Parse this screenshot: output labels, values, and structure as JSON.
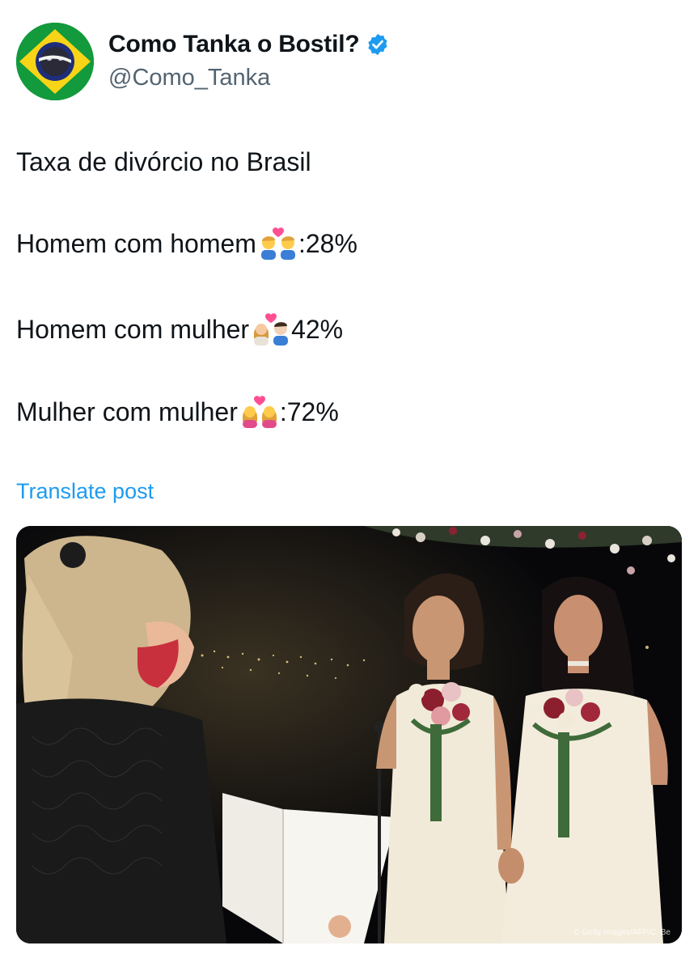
{
  "author": {
    "display_name": "Como Tanka o Bostil?",
    "handle": "@Como_Tanka",
    "verified_icon": "verified-badge-icon",
    "avatar": "brazil-flag-avatar"
  },
  "tweet": {
    "title": "Taxa de divórcio no Brasil",
    "lines": [
      {
        "label": "Homem com homem",
        "emoji": "couple-man-man-emoji",
        "value": ":28%"
      },
      {
        "label": "Homem com mulher",
        "emoji": "couple-woman-man-emoji",
        "value": "42%"
      },
      {
        "label": "Mulher com mulher",
        "emoji": "couple-woman-woman-emoji",
        "value": ":72%"
      }
    ]
  },
  "translate_label": "Translate post",
  "media": {
    "description_icon": "wedding-photo",
    "credit": "© Getty Images/AFP/C. Be"
  },
  "colors": {
    "link": "#1d9bf0",
    "secondary_text": "#536471",
    "verified": "#1d9bf0",
    "heart": "#ff4f93"
  }
}
